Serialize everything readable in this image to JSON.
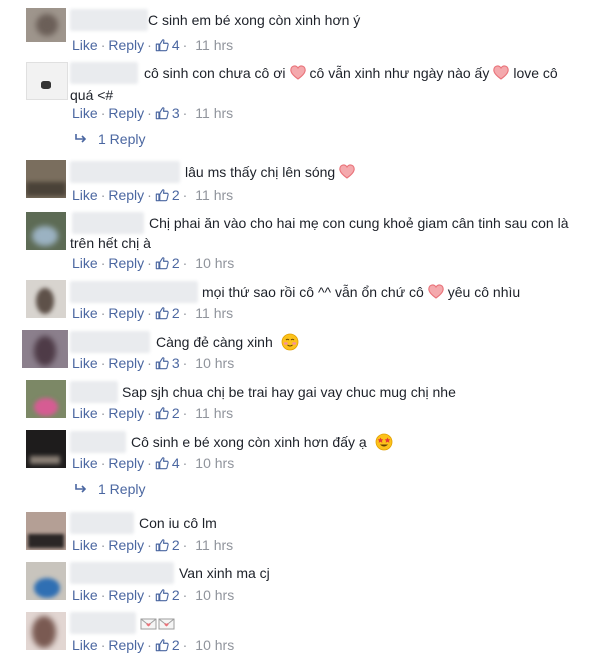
{
  "labels": {
    "like": "Like",
    "reply": "Reply",
    "sep": "·"
  },
  "colors": {
    "link": "#4b67a1",
    "meta": "#90949c",
    "heart": "#e9737a"
  },
  "icons": {
    "like": "thumbs-up-icon",
    "reply_arrow": "reply-arrow-icon",
    "heart": "heart-icon",
    "blush": "blushing-face-emoji",
    "star_eyes": "star-struck-emoji",
    "envelope": "love-letter-emoji"
  },
  "comments": [
    {
      "text": "C sinh em bé xong còn xinh hơn ý",
      "likes": "4",
      "time": "11 hrs"
    },
    {
      "text_a": "cô sinh con chưa cô ơi",
      "text_b": "cô vẫn xinh như ngày nào ấy",
      "text_c": "love cô",
      "text_d": "quá <#",
      "likes": "3",
      "time": "11 hrs",
      "replies": "1 Reply"
    },
    {
      "text": "lâu ms thấy chị lên sóng",
      "likes": "2",
      "time": "11 hrs"
    },
    {
      "text_a": "Chị phai ăn vào cho hai mẹ con cung khoẻ giam cân tinh sau con là",
      "text_b": "trên hết chị à",
      "likes": "2",
      "time": "10 hrs"
    },
    {
      "text_a": "mọi thứ sao rồi cô ^^ vẫn ổn chứ cô",
      "text_b": "yêu cô nhìu",
      "likes": "2",
      "time": "11 hrs"
    },
    {
      "text": "Càng đẻ càng xinh",
      "likes": "3",
      "time": "10 hrs"
    },
    {
      "text": "Sap sjh chua chị be trai hay gai vay chuc mug chị nhe",
      "likes": "2",
      "time": "11 hrs"
    },
    {
      "text": "Cô sinh e bé xong còn xinh hơn đấy ạ",
      "likes": "4",
      "time": "10 hrs",
      "replies": "1 Reply"
    },
    {
      "text": "Con iu cô lm",
      "likes": "2",
      "time": "11 hrs"
    },
    {
      "text": "Van xinh ma cj",
      "likes": "2",
      "time": "10 hrs"
    },
    {
      "text": "",
      "likes": "2",
      "time": "10 hrs"
    }
  ]
}
